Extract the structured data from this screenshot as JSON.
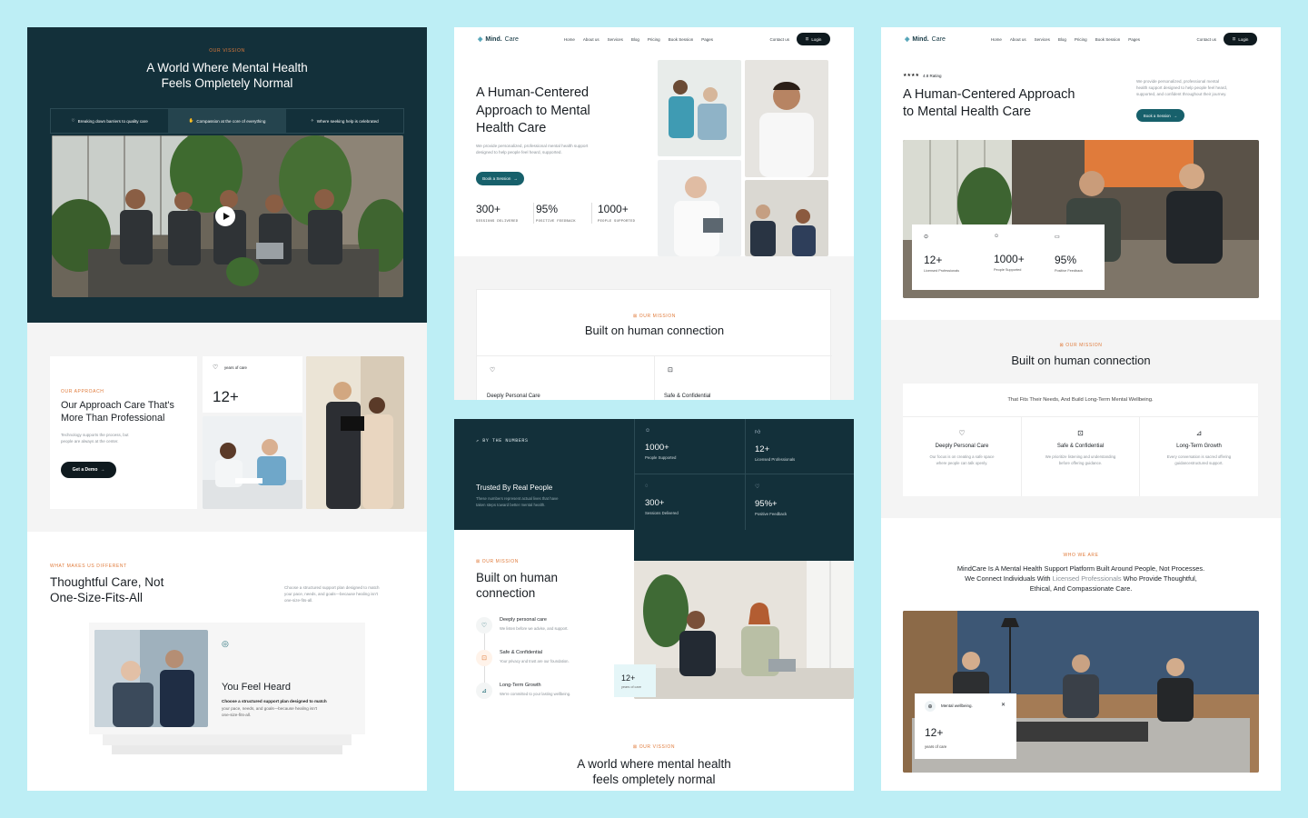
{
  "colors": {
    "page_bg": "#bdeef5",
    "dark_teal": "#13303a",
    "accent_orange": "#e07b3b",
    "teal_button": "#17606b"
  },
  "p1": {
    "eyebrow": "OUR VISSION",
    "title_l1": "A World Where Mental Health",
    "title_l2": "Feels Ompletely Normal",
    "tabs": [
      "Breaking down barriers to quality care",
      "Compassion at the core of everything",
      "Where seeking help is celebrated"
    ],
    "approach_eyebrow": "OUR APPROACH",
    "approach_title_l1": "Our Approach Care That's",
    "approach_title_l2": "More Than Professional",
    "approach_desc_l1": "Technology supports the process, but",
    "approach_desc_l2": "people are always at the center.",
    "demo_btn": "Get a Demo",
    "years_label": "years of care",
    "years_num": "12+",
    "diff_eyebrow": "WHAT MAKES US DIFFERENT",
    "diff_title_l1": "Thoughtful Care, Not",
    "diff_title_l2": "One-Size-Fits-All",
    "diff_desc_l1": "Choose a structured support plan designed to match",
    "diff_desc_l2": "your pace, needs, and goals—because healing isn't",
    "diff_desc_l3": "one-size-fits-all.",
    "card_title": "You Feel Heard",
    "card_desc_l1": "Choose a structured support plan designed to match",
    "card_desc_l2": "your pace, needs, and goals—because healing isn't",
    "card_desc_l3": "one-size-fits-all."
  },
  "nav": {
    "brand": "Mind.",
    "brand2": "Care",
    "links": [
      "Home",
      "About us",
      "Services",
      "Blog",
      "Pricing",
      "Book Session",
      "Pages"
    ],
    "contact": "Contact us",
    "login": "Login"
  },
  "p2": {
    "title_l1": "A Human-Centered",
    "title_l2": "Approach to Mental",
    "title_l3": "Health Care",
    "desc_l1": "We provide personalized, professional mental health support",
    "desc_l2": "designed to help people feel heard, supported.",
    "btn": "Book a Session",
    "stats": [
      {
        "num": "300+",
        "label": "SESSIONS DELIVERED"
      },
      {
        "num": "95%",
        "label": "POSITIVE FEEDBACK"
      },
      {
        "num": "1000+",
        "label": "PEOPLE SUPPORTED"
      }
    ],
    "mission_eyebrow": "OUR MISSION",
    "mission_title": "Built on human connection",
    "feat1": "Deeply Personal Care",
    "feat2": "Safe & Confidential"
  },
  "p3": {
    "rating_stars": "★★★★",
    "rating": "4.8 Rating",
    "title_l1": "A Human-Centered Approach",
    "title_l2": "to Mental Health Care",
    "desc_l1": "We provide personalized, professional mental",
    "desc_l2": "health support designed to help people feel heard,",
    "desc_l3": "supported, and confident throughout their journey.",
    "btn": "Book a Session",
    "stats": [
      {
        "num": "12+",
        "label": "Licensed Professionals"
      },
      {
        "num": "1000+",
        "label": "People Supported"
      },
      {
        "num": "95%",
        "label": "Positive Feedback"
      }
    ],
    "mission_eyebrow": "OUR MISSION",
    "mission_title": "Built on human connection",
    "mission_sub": "That Fits Their Needs, And Build Long-Term Mental Wellbeing.",
    "features": [
      {
        "title": "Deeply Personal Care",
        "d1": "Our focus is on creating a safe space",
        "d2": "where people can talk openly."
      },
      {
        "title": "Safe & Confidential",
        "d1": "We prioritize listening and understanding",
        "d2": "before offering guidance."
      },
      {
        "title": "Long-Term Growth",
        "d1": "Every conversation is sacred offering",
        "d2": "guidancestructured support."
      }
    ],
    "who_eyebrow": "WHO WE ARE",
    "who_l1": "MindCare Is A Mental Health Support Platform Built Around People, Not Processes.",
    "who_l2a": "We Connect Individuals With ",
    "who_l2b": "Licensed Professionals",
    "who_l2c": " Who Provide Thoughtful,",
    "who_l3": "Ethical, And Compassionate Care.",
    "badge_label": "Mental wellbeing.",
    "badge_num": "12+",
    "badge_sub": "years of care"
  },
  "p4": {
    "eyebrow": "BY THE NUMBERS",
    "title": "Trusted By Real People",
    "desc_l1": "These numbers represent actual lives that have",
    "desc_l2": "taken steps toward better mental health.",
    "stats": [
      {
        "num": "1000+",
        "label": "People Supported"
      },
      {
        "num": "12+",
        "label": "Licensed Professionals"
      },
      {
        "num": "300+",
        "label": "Sessions Delivered"
      },
      {
        "num": "95%+",
        "label": "Positive Feedback"
      }
    ],
    "mission_eyebrow": "OUR MISSION",
    "mission_title_l1": "Built on human",
    "mission_title_l2": "connection",
    "list": [
      {
        "title": "Deeply personal care",
        "desc": "We listen before we advise, and support."
      },
      {
        "title": "Safe & Confidential",
        "desc": "Your privacy and trust are our foundation."
      },
      {
        "title": "Long-Term Growth",
        "desc": "We're committed to your lasting wellbeing."
      }
    ],
    "badge_num": "12+",
    "badge_sub": "years of care",
    "vision_eyebrow": "OUR VISSION",
    "vision_l1": "A world where mental health",
    "vision_l2": "feels ompletely normal"
  }
}
